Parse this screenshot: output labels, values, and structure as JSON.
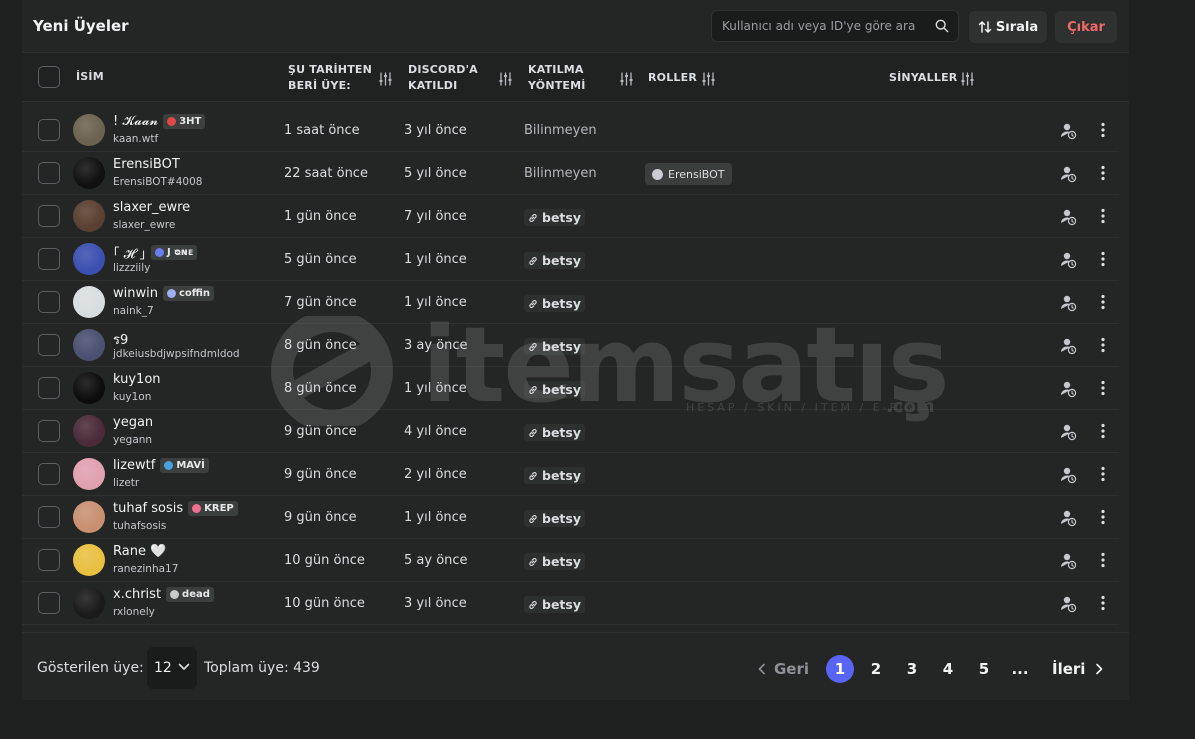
{
  "header": {
    "title": "Yeni Üyeler",
    "search_placeholder": "Kullanıcı adı veya ID'ye göre ara",
    "sort_label": "Sırala",
    "exit_label": "Çıkar"
  },
  "columns": {
    "name": "İSİM",
    "member_since_1": "ŞU TARİHTEN",
    "member_since_2": "BERİ ÜYE:",
    "discord_joined_1": "DISCORD'A",
    "discord_joined_2": "KATILDI",
    "join_method_1": "KATILMA",
    "join_method_2": "YÖNTEMİ",
    "roles": "ROLLER",
    "signals": "SİNYALLER"
  },
  "rows": [
    {
      "name": "! 𝓚𝓪𝓪𝓷",
      "handle": "kaan.wtf",
      "tag": "3HT",
      "tag_color": "#e04848",
      "since": "1 saat önce",
      "joined": "3 yıl önce",
      "method": "Bilinmeyen",
      "method_type": "plain",
      "role": "",
      "avatar_color": "#6b6250"
    },
    {
      "name": "ErensiBOT",
      "handle": "ErensiBOT#4008",
      "tag": "",
      "tag_color": "",
      "since": "22 saat önce",
      "joined": "5 yıl önce",
      "method": "Bilinmeyen",
      "method_type": "plain",
      "role": "ErensiBOT",
      "avatar_color": "#101010"
    },
    {
      "name": "slaxer_ewre",
      "handle": "slaxer_ewre",
      "tag": "",
      "tag_color": "",
      "since": "1 gün önce",
      "joined": "7 yıl önce",
      "method": "betsy",
      "method_type": "link",
      "role": "",
      "avatar_color": "#5a4030"
    },
    {
      "name": "｢ 𝓗 ｣",
      "handle": "lizzziily",
      "tag": "J ᴓɴᴇ",
      "tag_color": "#6a7cf0",
      "since": "5 gün önce",
      "joined": "1 yıl önce",
      "method": "betsy",
      "method_type": "link",
      "role": "",
      "avatar_color": "#3a4fb0"
    },
    {
      "name": "winwin",
      "handle": "naink_7",
      "tag": "coffin",
      "tag_color": "#a0b0f0",
      "since": "7 gün önce",
      "joined": "1 yıl önce",
      "method": "betsy",
      "method_type": "link",
      "role": "",
      "avatar_color": "#d8dde0"
    },
    {
      "name": "ร9",
      "handle": "jdkeiusbdjwpsifndmldod",
      "tag": "",
      "tag_color": "",
      "since": "8 gün önce",
      "joined": "3 ay önce",
      "method": "betsy",
      "method_type": "link",
      "role": "",
      "avatar_color": "#4a5070"
    },
    {
      "name": "kuy1on",
      "handle": "kuy1on",
      "tag": "",
      "tag_color": "",
      "since": "8 gün önce",
      "joined": "1 yıl önce",
      "method": "betsy",
      "method_type": "link",
      "role": "",
      "avatar_color": "#0c0c0c"
    },
    {
      "name": "yegan",
      "handle": "yegann",
      "tag": "",
      "tag_color": "",
      "since": "9 gün önce",
      "joined": "4 yıl önce",
      "method": "betsy",
      "method_type": "link",
      "role": "",
      "avatar_color": "#4a2a38"
    },
    {
      "name": "lizewtf",
      "handle": "lizetr",
      "tag": "MAVİ",
      "tag_color": "#4aa0e0",
      "since": "9 gün önce",
      "joined": "2 yıl önce",
      "method": "betsy",
      "method_type": "link",
      "role": "",
      "avatar_color": "#e0a0b0"
    },
    {
      "name": "tuhaf sosis",
      "handle": "tuhafsosis",
      "tag": "KREP",
      "tag_color": "#f07090",
      "since": "9 gün önce",
      "joined": "1 yıl önce",
      "method": "betsy",
      "method_type": "link",
      "role": "",
      "avatar_color": "#c89070"
    },
    {
      "name": "Rane 🤍",
      "handle": "ranezinha17",
      "tag": "",
      "tag_color": "",
      "since": "10 gün önce",
      "joined": "5 ay önce",
      "method": "betsy",
      "method_type": "link",
      "role": "",
      "avatar_color": "#e8c040"
    },
    {
      "name": "x.christ",
      "handle": "rxlonely",
      "tag": "dead",
      "tag_color": "#c8c8c8",
      "since": "10 gün önce",
      "joined": "3 yıl önce",
      "method": "betsy",
      "method_type": "link",
      "role": "",
      "avatar_color": "#1a1a1a"
    }
  ],
  "footer": {
    "shown_label": "Gösterilen üye:",
    "page_size": "12",
    "total_label": "Toplam üye: 439",
    "prev_label": "Geri",
    "next_label": "İleri",
    "pages": [
      "1",
      "2",
      "3",
      "4",
      "5",
      "..."
    ],
    "active_page": "1"
  },
  "watermark": {
    "brand": "itemsatış",
    "sub": "HESAP / SKIN / ITEM / E-PIN",
    "com": ".com"
  }
}
